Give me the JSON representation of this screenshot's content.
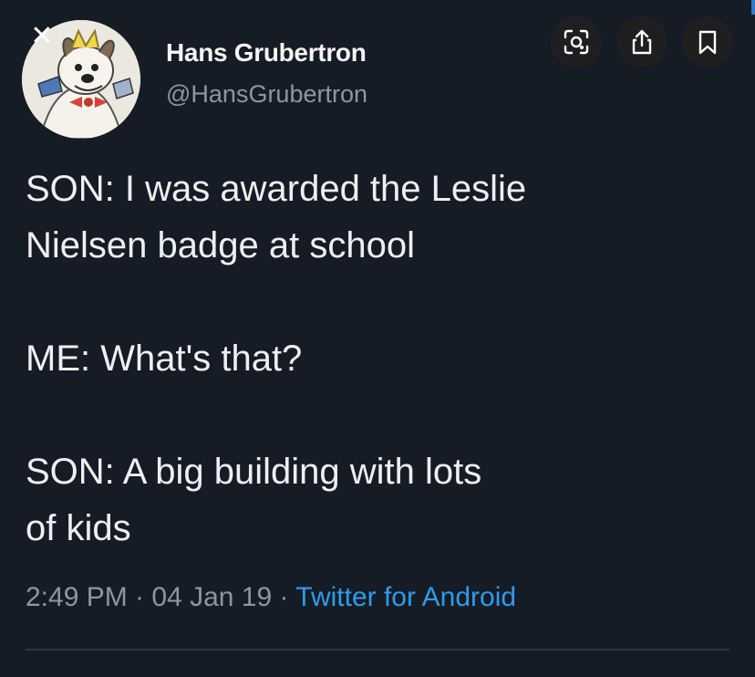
{
  "viewer": {
    "close_label": "✕",
    "actions": [
      {
        "name": "lens-icon"
      },
      {
        "name": "share-icon"
      },
      {
        "name": "bookmark-icon"
      }
    ]
  },
  "tweet": {
    "author_name": "Hans Grubertron",
    "author_handle": "@HansGrubertron",
    "lines": [
      "SON: I was awarded the Leslie",
      "Nielsen badge at school",
      "ME: What's that?",
      "SON: A big building with lots",
      "of kids"
    ],
    "timestamp": "2:49 PM · 04 Jan 19 ·",
    "source": "Twitter for Android"
  },
  "colors": {
    "background": "#151c26",
    "source_link": "#2f9bea",
    "muted_text": "#8a97a5"
  }
}
